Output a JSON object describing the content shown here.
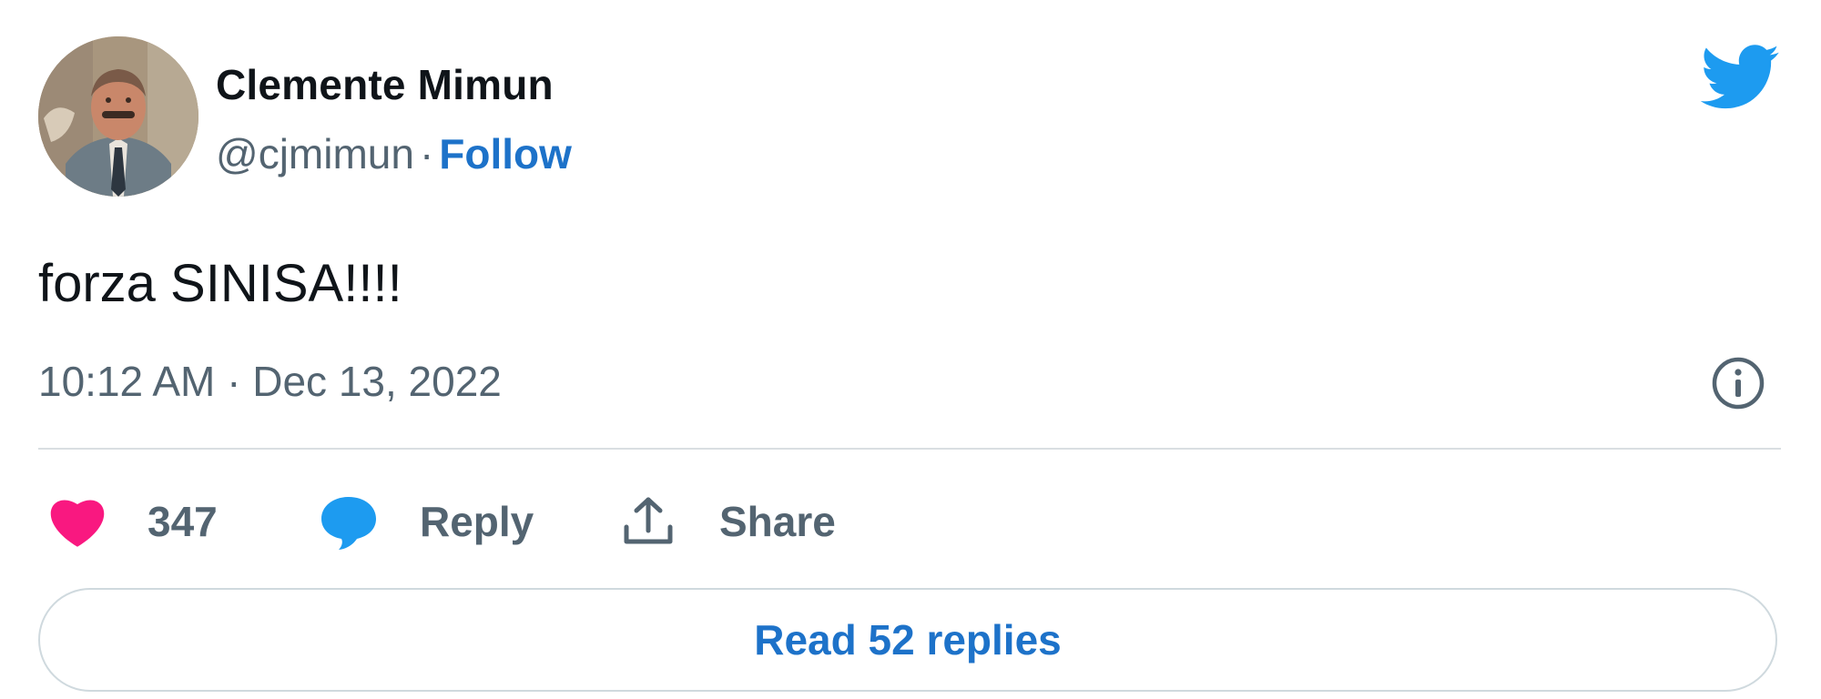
{
  "author": {
    "display_name": "Clemente Mimun",
    "handle": "@cjmimun",
    "separator": "·",
    "follow_label": "Follow"
  },
  "tweet": {
    "text": "forza SINISA!!!!",
    "timestamp": "10:12 AM · Dec 13, 2022"
  },
  "actions": {
    "like_count": "347",
    "reply_label": "Reply",
    "share_label": "Share"
  },
  "read_replies_label": "Read 52 replies",
  "icons": {
    "brand": "twitter-bird-icon",
    "info": "info-icon",
    "like": "heart-icon",
    "reply": "speech-bubble-icon",
    "share": "share-arrow-icon"
  },
  "colors": {
    "brand_blue": "#1d9bf0",
    "link_blue": "#1d72c9",
    "like_pink": "#f91880",
    "text_dark": "#0f1419",
    "text_gray": "#536471"
  }
}
